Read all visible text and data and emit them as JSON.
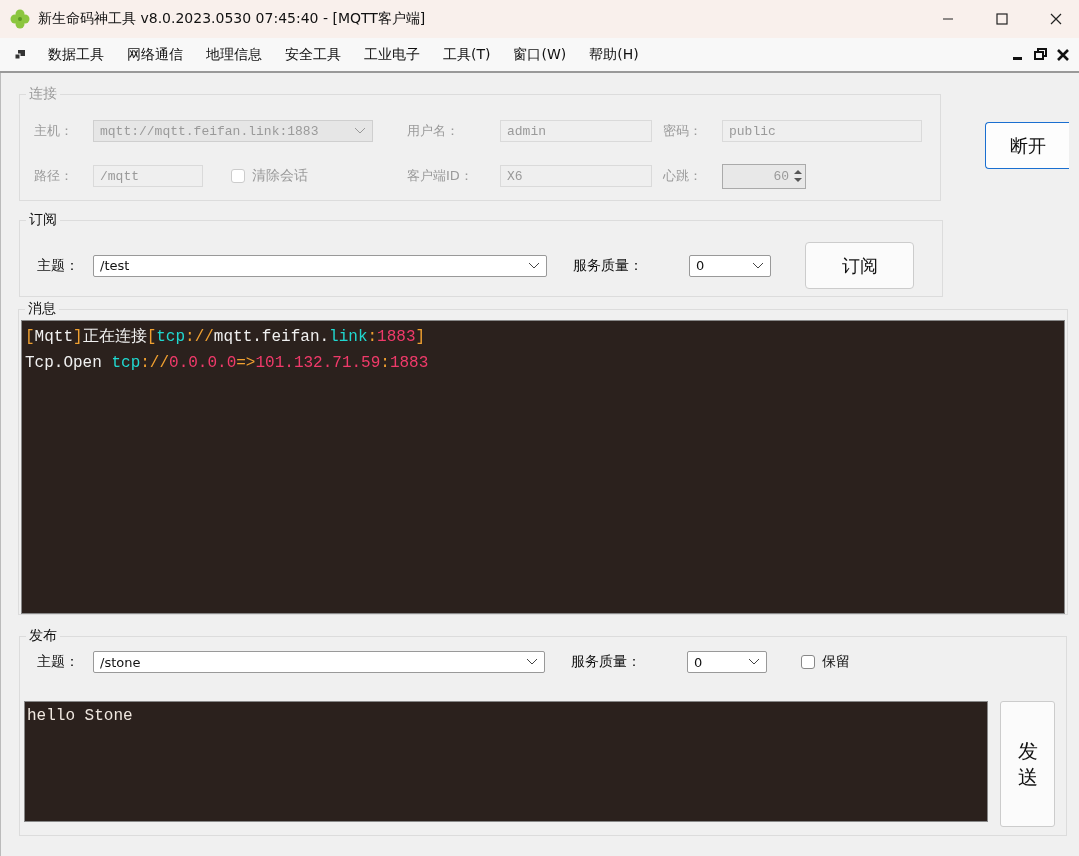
{
  "window": {
    "title": "新生命码神工具 v8.0.2023.0530 07:45:40 - [MQTT客户端]"
  },
  "menu": [
    "数据工具",
    "网络通信",
    "地理信息",
    "安全工具",
    "工业电子",
    "工具(T)",
    "窗口(W)",
    "帮助(H)"
  ],
  "connection": {
    "title": "连接",
    "disabled": true,
    "host": {
      "label": "主机：",
      "value": "mqtt://mqtt.feifan.link:1883"
    },
    "username": {
      "label": "用户名：",
      "value": "admin"
    },
    "password": {
      "label": "密码：",
      "value": "public"
    },
    "path": {
      "label": "路径：",
      "value": "/mqtt"
    },
    "clean_session": {
      "label": "清除会话",
      "checked": false
    },
    "client_id": {
      "label": "客户端ID：",
      "value": "X6"
    },
    "heartbeat": {
      "label": "心跳：",
      "value": "60"
    },
    "button": "断开"
  },
  "subscribe": {
    "title": "订阅",
    "topic_label": "主题：",
    "topic": "/test",
    "qos_label": "服务质量：",
    "qos": "0",
    "button": "订阅"
  },
  "messages": {
    "title": "消息",
    "lines": [
      [
        {
          "t": "[",
          "color": "#f0a030"
        },
        {
          "t": "Mqtt",
          "color": "#f0f0f0"
        },
        {
          "t": "]",
          "color": "#f0a030"
        },
        {
          "t": "正在连接",
          "color": "#f0f0f0"
        },
        {
          "t": "[",
          "color": "#f0a030"
        },
        {
          "t": "tcp",
          "color": "#20d8d0"
        },
        {
          "t": "://",
          "color": "#f0a030"
        },
        {
          "t": "mqtt.feifan.",
          "color": "#f0f0f0"
        },
        {
          "t": "link",
          "color": "#20d8d0"
        },
        {
          "t": ":",
          "color": "#f0a030"
        },
        {
          "t": "1883",
          "color": "#f03a6a"
        },
        {
          "t": "]",
          "color": "#f0a030"
        }
      ],
      [
        {
          "t": "Tcp.Open ",
          "color": "#f0f0f0"
        },
        {
          "t": "tcp",
          "color": "#20d8d0"
        },
        {
          "t": "://",
          "color": "#f0a030"
        },
        {
          "t": "0.0.0.0",
          "color": "#f03a6a"
        },
        {
          "t": "=>",
          "color": "#f0a030"
        },
        {
          "t": "101.132.71.59",
          "color": "#f03a6a"
        },
        {
          "t": ":",
          "color": "#f0a030"
        },
        {
          "t": "1883",
          "color": "#f03a6a"
        }
      ]
    ]
  },
  "publish": {
    "title": "发布",
    "topic_label": "主题：",
    "topic": "/stone",
    "qos_label": "服务质量：",
    "qos": "0",
    "retain": {
      "label": "保留",
      "checked": false
    },
    "body": "hello Stone",
    "button": "发送"
  }
}
